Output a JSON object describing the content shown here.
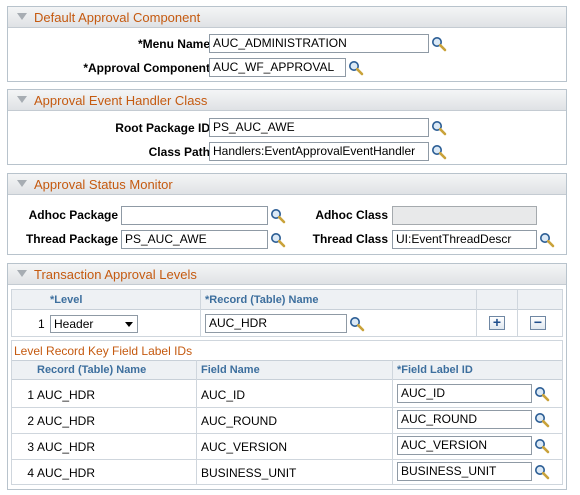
{
  "sections": {
    "default_component": {
      "title": "Default Approval Component",
      "menu_name_label": "*Menu Name",
      "menu_name_value": "AUC_ADMINISTRATION",
      "approval_component_label": "*Approval Component",
      "approval_component_value": "AUC_WF_APPROVAL"
    },
    "event_handler": {
      "title": "Approval Event Handler Class",
      "root_package_label": "Root Package ID",
      "root_package_value": "PS_AUC_AWE",
      "class_path_label": "Class Path",
      "class_path_value": "Handlers:EventApprovalEventHandler"
    },
    "status_monitor": {
      "title": "Approval Status Monitor",
      "adhoc_package_label": "Adhoc Package",
      "adhoc_package_value": "",
      "adhoc_class_label": "Adhoc Class",
      "adhoc_class_value": "",
      "thread_package_label": "Thread Package",
      "thread_package_value": "PS_AUC_AWE",
      "thread_class_label": "Thread Class",
      "thread_class_value": "UI:EventThreadDescr"
    },
    "levels": {
      "title": "Transaction Approval Levels",
      "level_header": "*Level",
      "record_header": "*Record (Table) Name",
      "row_num": "1",
      "level_value": "Header",
      "record_value": "AUC_HDR",
      "add_glyph": "+",
      "remove_glyph": "−",
      "key_grid": {
        "title": "Level Record Key Field Label IDs",
        "headers": {
          "record": "Record (Table) Name",
          "field": "Field Name",
          "label_id": "*Field Label ID"
        },
        "rows": [
          {
            "num": "1",
            "record": "AUC_HDR",
            "field": "AUC_ID",
            "label_id": "AUC_ID"
          },
          {
            "num": "2",
            "record": "AUC_HDR",
            "field": "AUC_ROUND",
            "label_id": "AUC_ROUND"
          },
          {
            "num": "3",
            "record": "AUC_HDR",
            "field": "AUC_VERSION",
            "label_id": "AUC_VERSION"
          },
          {
            "num": "4",
            "record": "AUC_HDR",
            "field": "BUSINESS_UNIT",
            "label_id": "BUSINESS_UNIT"
          }
        ]
      }
    }
  },
  "icons": {
    "lookup": "lookup-magnifier-icon",
    "collapse": "collapse-triangle-icon"
  },
  "colors": {
    "section_title": "#c55a10",
    "column_header": "#3d6f9e"
  }
}
